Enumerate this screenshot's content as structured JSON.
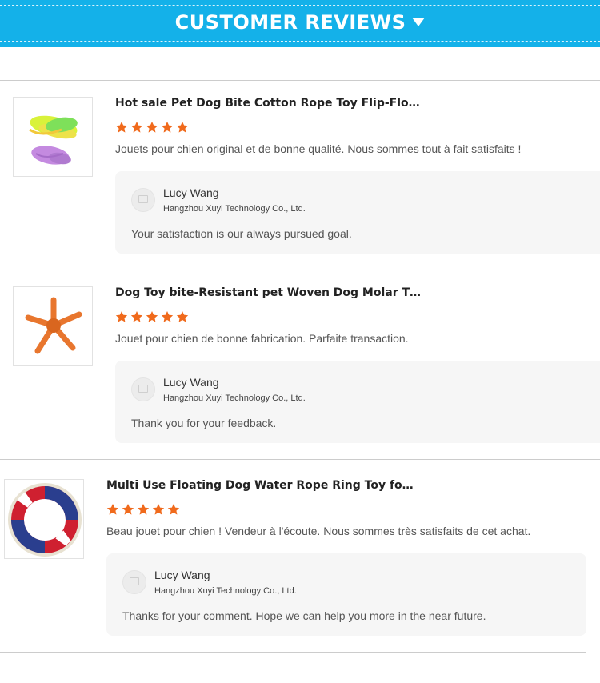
{
  "header": {
    "title": "CUSTOMER REVIEWS",
    "caret_icon": "caret-down-icon",
    "bg_color": "#14b1e9"
  },
  "rating_color": "#f06a1c",
  "reviews": [
    {
      "product_title": "Hot sale Pet Dog Bite Cotton Rope Toy Flip-Flo…",
      "rating": 5,
      "comment": "Jouets pour chien original et de bonne qualité. Nous sommes tout à fait satisfaits !",
      "reply": {
        "name": "Lucy Wang",
        "company": "Hangzhou Xuyi Technology Co., Ltd.",
        "text": "Your satisfaction is our always pursued goal."
      }
    },
    {
      "product_title": "Dog Toy bite-Resistant pet Woven Dog Molar T…",
      "rating": 5,
      "comment": "Jouet pour chien de bonne fabrication. Parfaite transaction.",
      "reply": {
        "name": "Lucy Wang",
        "company": "Hangzhou Xuyi Technology Co., Ltd.",
        "text": "Thank you for your feedback."
      }
    },
    {
      "product_title": "Multi Use Floating Dog Water Rope Ring Toy fo…",
      "rating": 5,
      "comment": "Beau jouet pour chien ! Vendeur à l'écoute. Nous sommes très satisfaits de cet achat.",
      "reply": {
        "name": "Lucy Wang",
        "company": "Hangzhou Xuyi Technology Co., Ltd.",
        "text": "Thanks for your comment. Hope we can help you more in the near future."
      }
    }
  ]
}
